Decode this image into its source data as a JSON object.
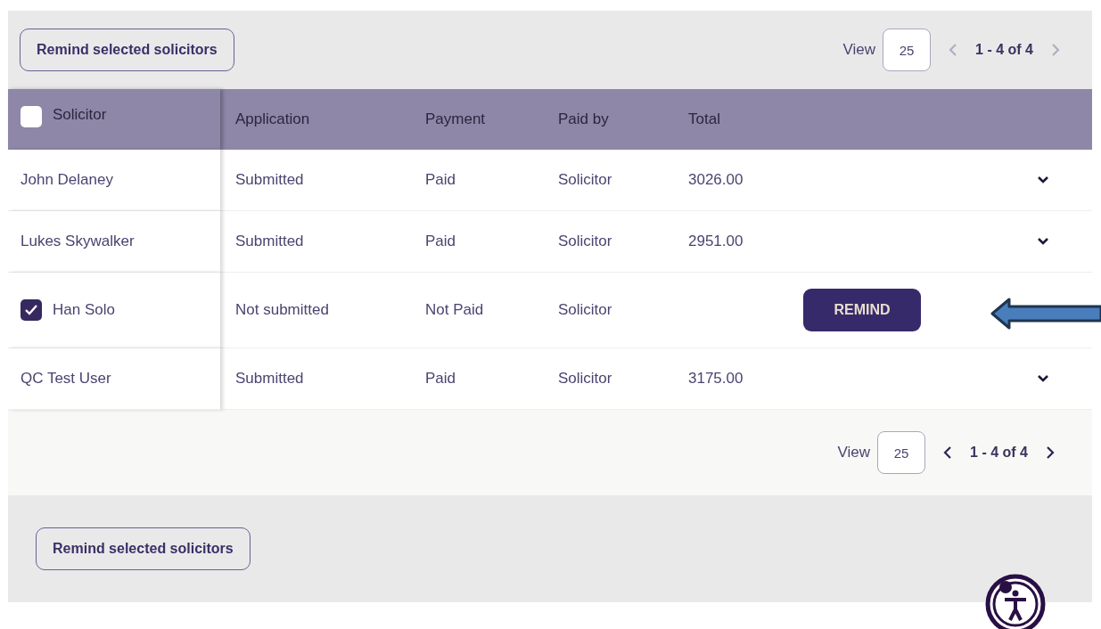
{
  "top_toolbar": {
    "button": "Remind selected solicitors",
    "pager": {
      "view_label": "View",
      "page_size": "25",
      "range": "1 - 4 of 4",
      "prev_disabled": true,
      "next_disabled": true
    }
  },
  "table": {
    "select_all": {
      "checked": false
    },
    "columns": [
      "Solicitor",
      "Application",
      "Payment",
      "Paid by",
      "Total"
    ],
    "rows": [
      {
        "solicitor": "John Delaney",
        "checked": false,
        "application": "Submitted",
        "payment": "Paid",
        "paid_by": "Solicitor",
        "total": "3026.00",
        "action": {
          "kind": "expand"
        }
      },
      {
        "solicitor": "Lukes Skywalker",
        "checked": false,
        "application": "Submitted",
        "payment": "Paid",
        "paid_by": "Solicitor",
        "total": "2951.00",
        "action": {
          "kind": "expand"
        }
      },
      {
        "solicitor": "Han Solo",
        "checked": true,
        "application": "Not submitted",
        "payment": "Not Paid",
        "paid_by": "Solicitor",
        "action": {
          "kind": "remind",
          "label": "REMIND"
        }
      },
      {
        "solicitor": "QC Test User",
        "checked": false,
        "application": "Submitted",
        "payment": "Paid",
        "paid_by": "Solicitor",
        "total": "3175.00",
        "action": {
          "kind": "expand"
        }
      }
    ]
  },
  "bottom_pager": {
    "view_label": "View",
    "page_size": "25",
    "range": "1 - 4 of 4",
    "prev_disabled": false,
    "next_disabled": false
  },
  "bottom_toolbar": {
    "button": "Remind selected solicitors"
  }
}
